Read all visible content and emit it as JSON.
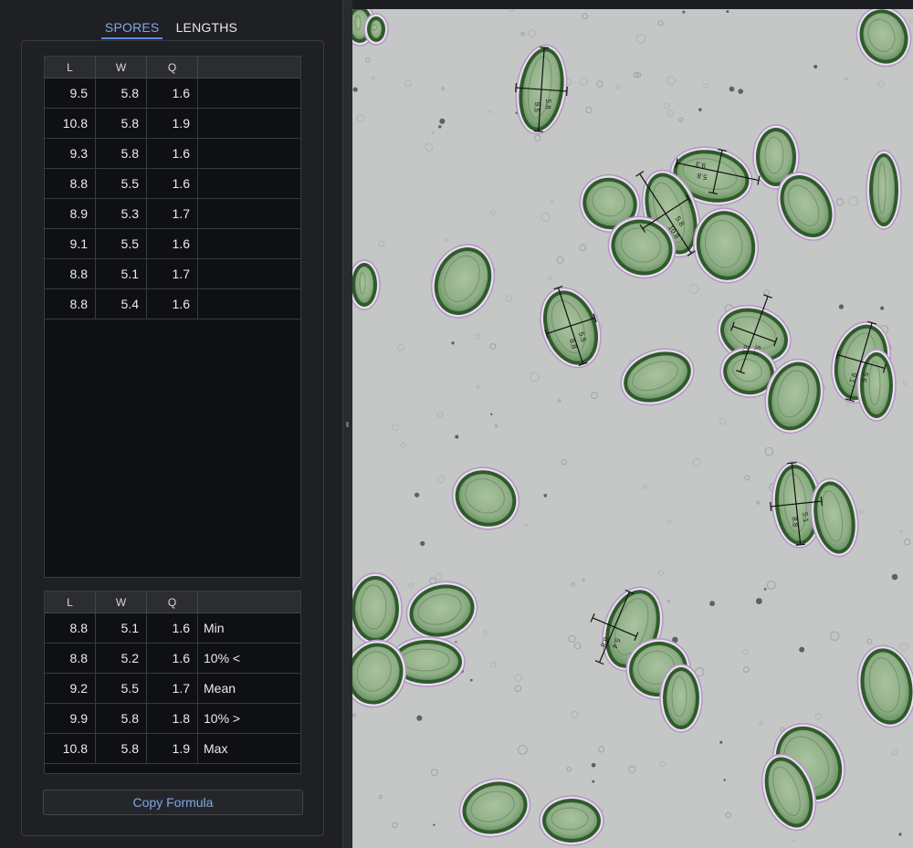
{
  "tabs": {
    "spores": "SPORES",
    "lengths": "LENGTHS"
  },
  "spores_table": {
    "headers": [
      "L",
      "W",
      "Q",
      ""
    ],
    "rows": [
      [
        "9.5",
        "5.8",
        "1.6"
      ],
      [
        "10.8",
        "5.8",
        "1.9"
      ],
      [
        "9.3",
        "5.8",
        "1.6"
      ],
      [
        "8.8",
        "5.5",
        "1.6"
      ],
      [
        "8.9",
        "5.3",
        "1.7"
      ],
      [
        "9.1",
        "5.5",
        "1.6"
      ],
      [
        "8.8",
        "5.1",
        "1.7"
      ],
      [
        "8.8",
        "5.4",
        "1.6"
      ]
    ]
  },
  "stats_table": {
    "headers": [
      "L",
      "W",
      "Q",
      ""
    ],
    "rows": [
      [
        "8.8",
        "5.1",
        "1.6",
        "Min"
      ],
      [
        "8.8",
        "5.2",
        "1.6",
        "10% <"
      ],
      [
        "9.2",
        "5.5",
        "1.7",
        "Mean"
      ],
      [
        "9.9",
        "5.8",
        "1.8",
        "10% >"
      ],
      [
        "10.8",
        "5.8",
        "1.9",
        "Max"
      ]
    ]
  },
  "copy_button": "Copy Formula",
  "measurements": [
    {
      "length": "9.5",
      "width": "5.8"
    },
    {
      "length": "10.8",
      "width": "5.8"
    },
    {
      "length": "9.3",
      "width": "5.8"
    },
    {
      "length": "8.8",
      "width": "5.5"
    },
    {
      "length": "8.9",
      "width": "5.3"
    },
    {
      "length": "9.1",
      "width": "5.5"
    },
    {
      "length": "8.8",
      "width": "5.1"
    },
    {
      "length": "8.8",
      "width": "5.4"
    }
  ],
  "colors": {
    "accent": "#7ea9ea",
    "panel_bg": "#1f2024",
    "table_bg": "#0f1013",
    "image_bg": "#c4c7c6",
    "spore_fill": "#8fae86",
    "spore_rim": "#2f5a2c"
  }
}
